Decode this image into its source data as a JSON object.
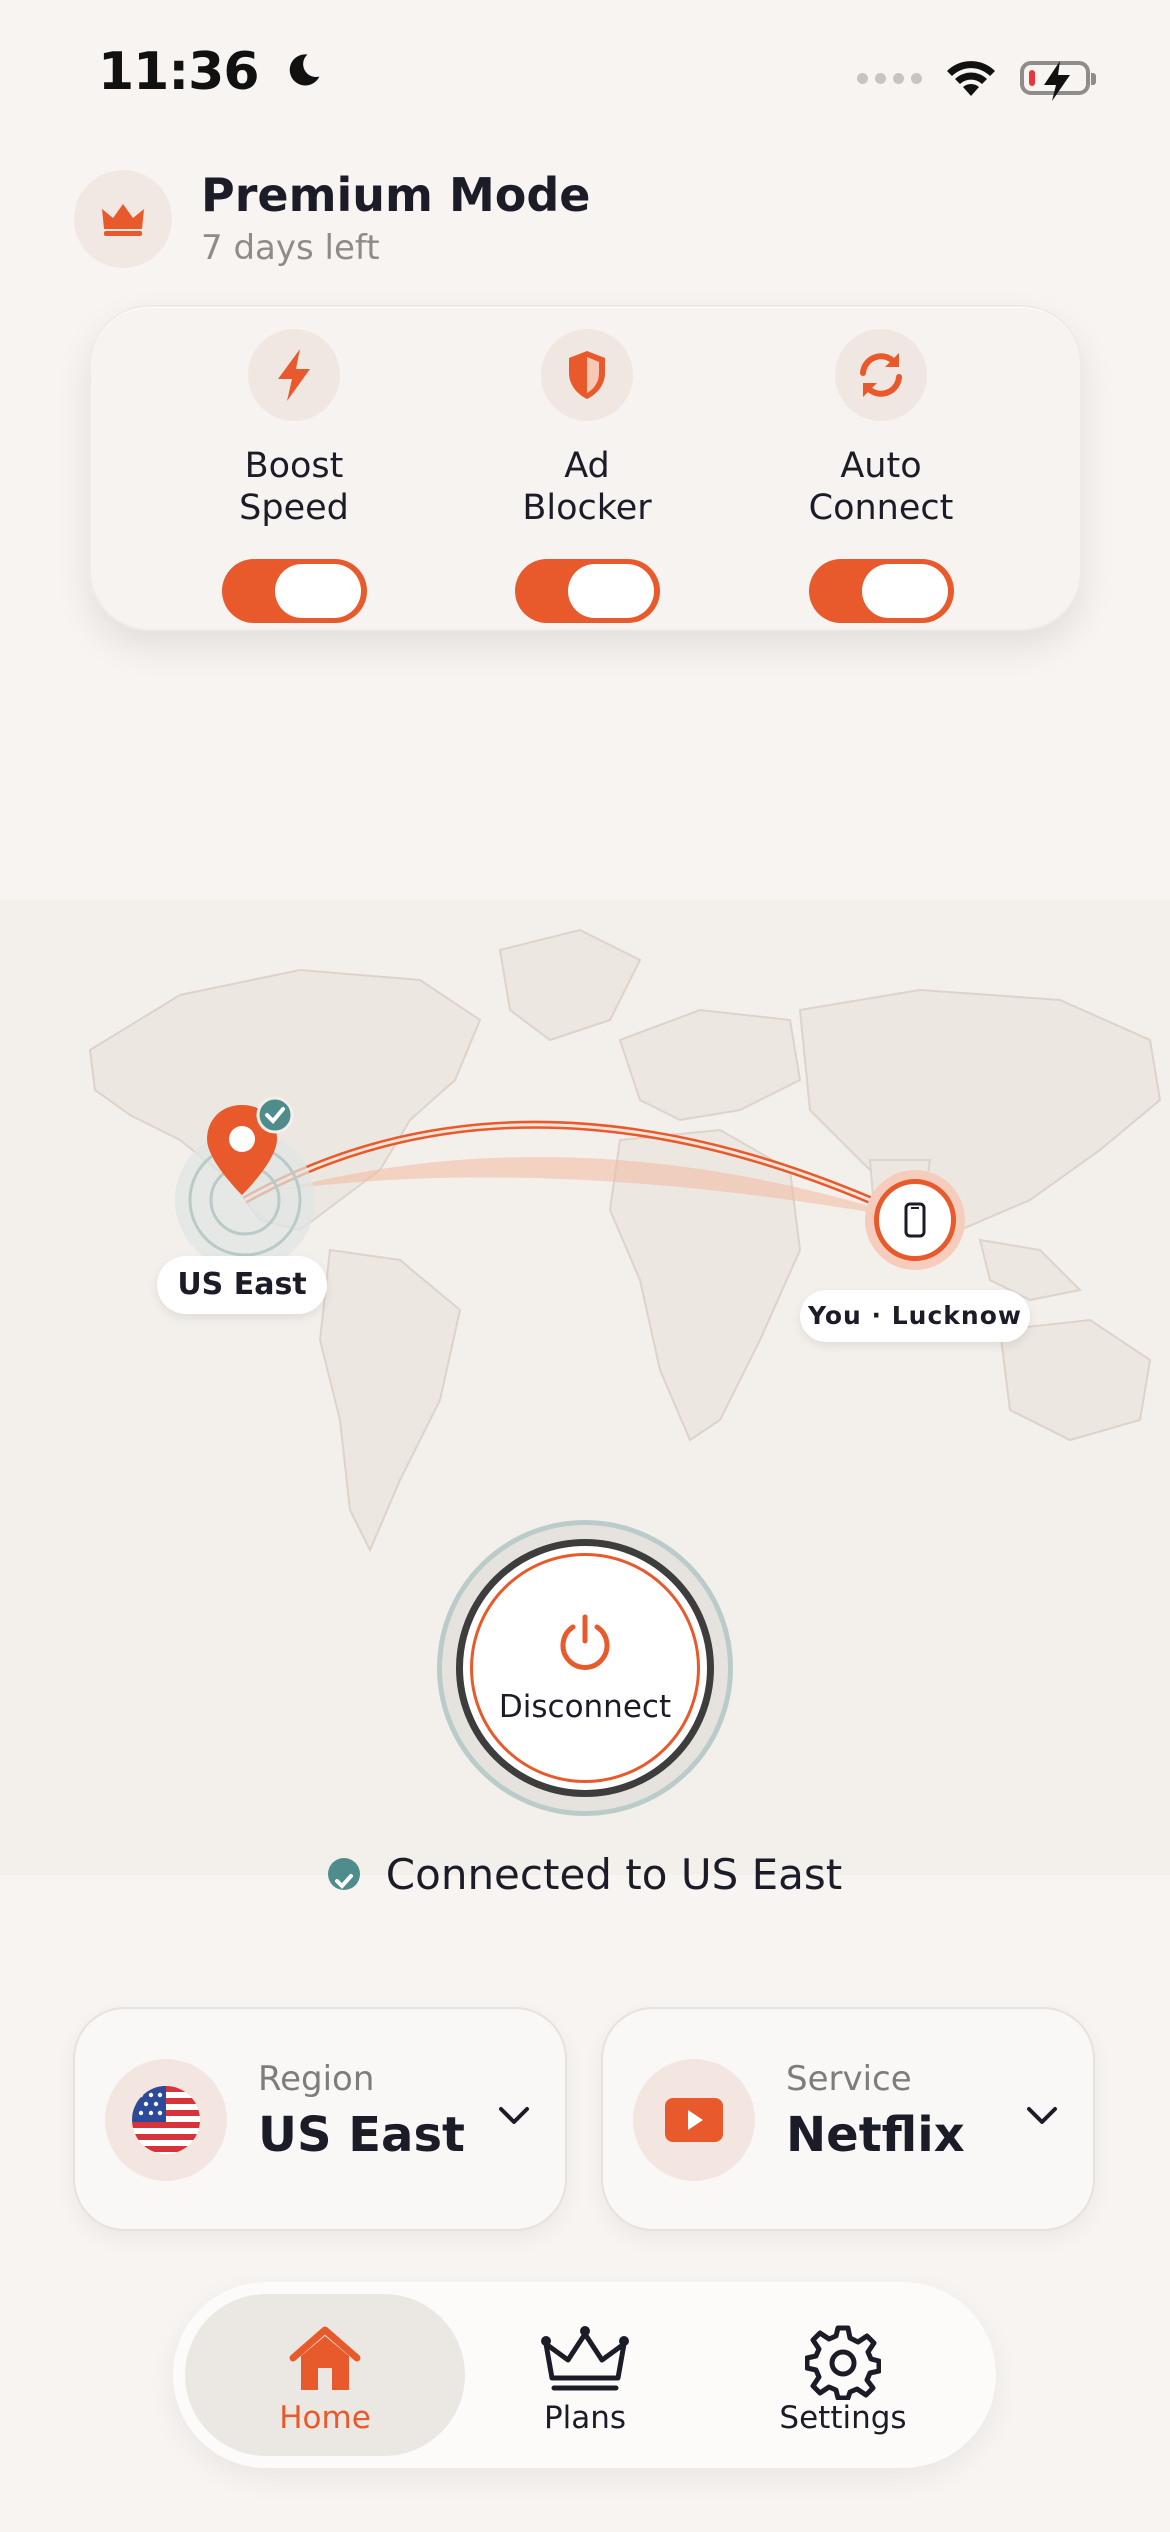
{
  "status_bar": {
    "time": "11:36"
  },
  "premium": {
    "title": "Premium Mode",
    "subtitle": "7 days left"
  },
  "features": [
    {
      "label": "Boost\nSpeed",
      "on": true
    },
    {
      "label": "Ad\nBlocker",
      "on": true
    },
    {
      "label": "Auto\nConnect",
      "on": true
    }
  ],
  "map": {
    "server_label": "US East",
    "you_label": "You · Lucknow"
  },
  "power_button": {
    "label": "Disconnect"
  },
  "connection_status": "Connected to US East",
  "region": {
    "caption": "Region",
    "value": "US East"
  },
  "service": {
    "caption": "Service",
    "value": "Netflix"
  },
  "tabs": [
    {
      "label": "Home",
      "active": true
    },
    {
      "label": "Plans",
      "active": false
    },
    {
      "label": "Settings",
      "active": false
    }
  ],
  "colors": {
    "accent": "#e8592b",
    "teal": "#4e8d8b",
    "background": "#f7f4f1"
  }
}
